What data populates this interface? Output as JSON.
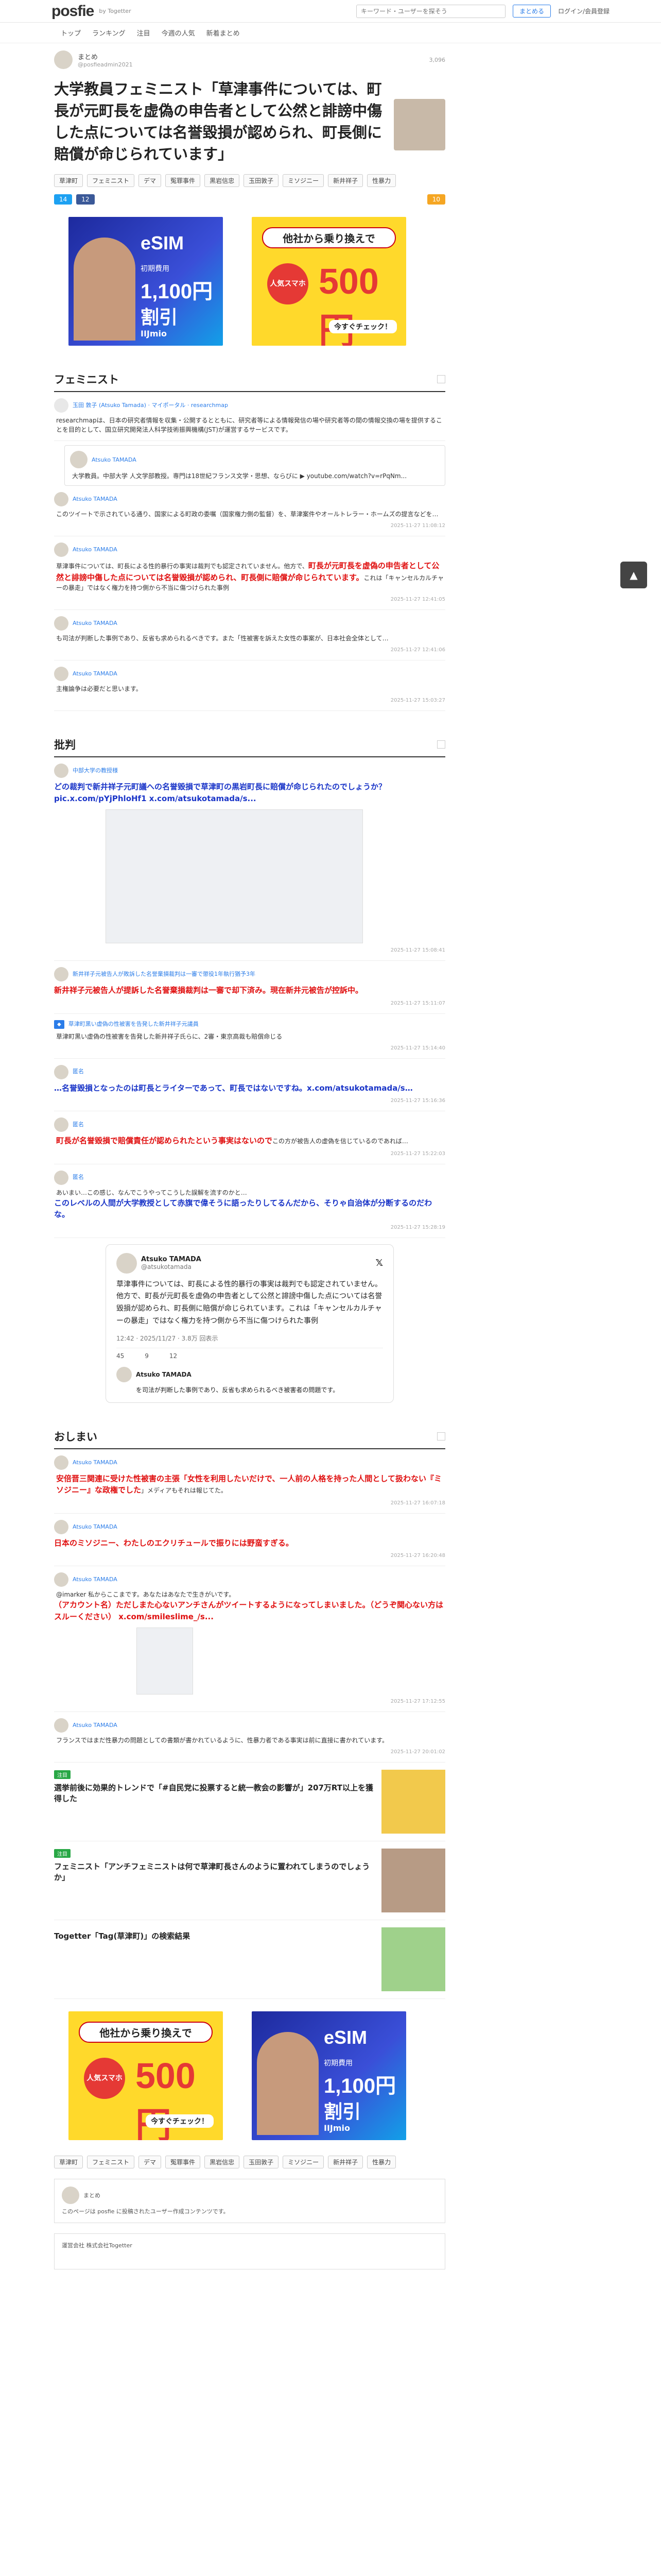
{
  "header": {
    "logo": "posfie",
    "logo_sub": "by Togetter",
    "search_placeholder": "キーワード・ユーザーを探そう",
    "post_button": "まとめる",
    "login": "ログイン/会員登録"
  },
  "nav": [
    "トップ",
    "ランキング",
    "注目",
    "今週の人気",
    "新着まとめ"
  ],
  "article": {
    "author_name": "まとめ",
    "author_id": "@posfieadmin2021",
    "date": "3,096",
    "title": "大学教員フェミニスト「草津事件については、町長が元町長を虚偽の申告者として公然と誹謗中傷した点については名誉毀損が認められ、町長側に賠償が命じられています」",
    "tags": [
      "草津町",
      "フェミニスト",
      "デマ",
      "冤罪事件",
      "黒岩信忠",
      "玉田敦子",
      "ミソジニー",
      "新井祥子",
      "性暴力"
    ],
    "share_counts": {
      "b": "14",
      "p": "12",
      "like": "10"
    }
  },
  "ads": {
    "esim_top": "eSIM",
    "esim_mid": "初期費用",
    "esim_price": "1,100円",
    "esim_cta": "割引",
    "esim_foot": "IIJmio",
    "y_top": "他社から乗り換えで",
    "y_circle": "人気スマホ",
    "y_price": "500円",
    "y_cta": "今すぐチェック！"
  },
  "sections": [
    {
      "title": "フェミニスト",
      "posts": [
        {
          "name": "玉田 敦子 (Atsuko Tamada) · マイポータル · researchmap",
          "body": "researchmapは、日本の研究者情報を収集・公開するとともに、研究者等による情報発信の場や研究者等の間の情報交換の場を提供することを目的として、国立研究開発法人科学技術振興機構(JST)が運営するサービスです。",
          "date": ""
        },
        {
          "name": "Atsuko TAMADA",
          "body": "大学教員。中部大学 人文学部教授。専門は18世紀フランス文学・思想、ならびに ▶ youtube.com/watch?v=rPqNm...",
          "date": ""
        },
        {
          "name": "Atsuko TAMADA",
          "body": "このツイートで示されている通り、国家による町政の委嘱（国家権力側の監督）を、草津案件やオールトレラー・ホームズの提言などを…",
          "date": "2025-11-27 11:08:12"
        },
        {
          "name": "Atsuko TAMADA",
          "body": "草津事件については、町長による性的暴行の事実は裁判でも認定されていません。他方で、",
          "red": "町長が元町長を虚偽の申告者として公然と誹謗中傷した点については名誉毀損が認められ、町長側に賠償が命じられています。",
          "tail": "これは「キャンセルカルチャーの暴走」ではなく権力を持つ側から不当に傷つけられた事例",
          "date": "2025-11-27 12:41:05"
        },
        {
          "name": "Atsuko TAMADA",
          "body": "も司法が判断した事例であり、反省も求められるべきです。また「性被害を訴えた女性の事案が、日本社会全体として…",
          "date": "2025-11-27 12:41:06"
        },
        {
          "name": "Atsuko TAMADA",
          "body": "主権論争は必要だと思います。",
          "date": "2025-11-27 15:03:27"
        }
      ]
    },
    {
      "title": "批判",
      "posts": [
        {
          "name": "中部大学の教授様",
          "blue": "どの裁判で新井祥子元町議への名誉毀損で草津町の黒岩町長に賠償が命じられたのでしょうか？ pic.x.com/pYjPhloHf1 x.com/atsukotamada/s...",
          "date": "2025-11-27 15:08:41"
        },
        {
          "name": "新井祥子元被告人が敗訴した名誉棄損裁判は一審で懲役1年執行猶予3年",
          "red": "新井祥子元被告人が提訴した名誉棄損裁判は一審で却下済み。現在新井元被告が控訴中。",
          "date": "2025-11-27 15:11:07"
        },
        {
          "name": "草津町黒い虚偽の性被害を告発した新井祥子元議員",
          "body": "草津町黒い虚偽の性被害を告発した新井祥子氏らに、2審・東京高裁も賠償命じる",
          "date": "2025-11-27 15:14:40"
        },
        {
          "name": "匿名",
          "blue": "…名誉毀損となったのは町長とライターであって、町長ではないですね。x.com/atsukotamada/s…",
          "date": "2025-11-27 15:16:36"
        },
        {
          "name": "匿名",
          "red": "町長が名誉毀損で賠償責任が認められたという事実はないので",
          "body": "この方が被告人の虚偽を信じているのであれば…",
          "date": "2025-11-27 15:22:03"
        },
        {
          "name": "匿名",
          "body": "あいまい…この感じ、なんでこうやってこうした誤解を流すのかと…",
          "blue": "このレベルの人間が大学教授として赤旗で偉そうに語ったりしてるんだから、そりゃ自治体が分断するのだわな。",
          "date": "2025-11-27 15:28:19"
        }
      ]
    },
    {
      "title": "おしまい",
      "posts": [
        {
          "name": "Atsuko TAMADA",
          "red": "安倍晋三関連に受けた性被害の主張「女性を利用したいだけで、一人前の人格を持った人間として扱わない『ミソジニー』な政権でした",
          "body": "」メディアもそれは報じてた。",
          "date": "2025-11-27 16:07:18"
        },
        {
          "name": "Atsuko TAMADA",
          "red": "日本のミソジニー、わたしのエクリチュールで振りには野蛮すぎる。",
          "date": "2025-11-27 16:20:48"
        },
        {
          "name": "Atsuko TAMADA",
          "body": "@imarker 私からここまです。あなたはあなたで生きがいです。",
          "red": "（アカウント名）ただしまた心ないアンチさんがツイートするようになってしまいました。（どうぞ関心ない方はスルーください） x.com/smileslime_/s...",
          "date": "2025-11-27 17:12:55"
        },
        {
          "name": "Atsuko TAMADA",
          "body": "フランスではまだ性暴力の問題としての書類が書かれているように、性暴力者である事実は前に直接に書かれています。",
          "date": "2025-11-27 20:01:02"
        }
      ]
    }
  ],
  "tweet": {
    "name": "Atsuko TAMADA",
    "handle": "@atsukotamada",
    "text": "草津事件については、町長による性的暴行の事実は裁判でも認定されていません。他方で、町長が元町長を虚偽の申告者として公然と誹謗中傷した点については名誉毀損が認められ、町長側に賠償が命じられています。これは「キャンセルカルチャーの暴走」ではなく権力を持つ側から不当に傷つけられた事例",
    "time": "12:42 · 2025/11/27 · 3.8万 回表示",
    "stats": [
      "45",
      "9",
      "12"
    ],
    "reply_name": "Atsuko TAMADA",
    "reply_text": "を司法が判断した事例であり、反省も求められるべき被害者の問題です。"
  },
  "related": [
    {
      "title": "選挙前後に効果的トレンドで「#自民党に投票すると統一教会の影響が」207万RT以上を獲得した",
      "badge": "注目"
    },
    {
      "title": "フェミニスト「アンチフェミニストは何で草津町長さんのように置われてしまうのでしょうか」",
      "badge": "注目"
    },
    {
      "title": "Togetter「Tag(草津町)」の検索結果",
      "badge": ""
    }
  ],
  "footer": {
    "copyright": "運営会社 株式会社Togetter",
    "note": "このページは posfie に投稿されたユーザー作成コンテンツです。"
  },
  "side_button": "▲"
}
